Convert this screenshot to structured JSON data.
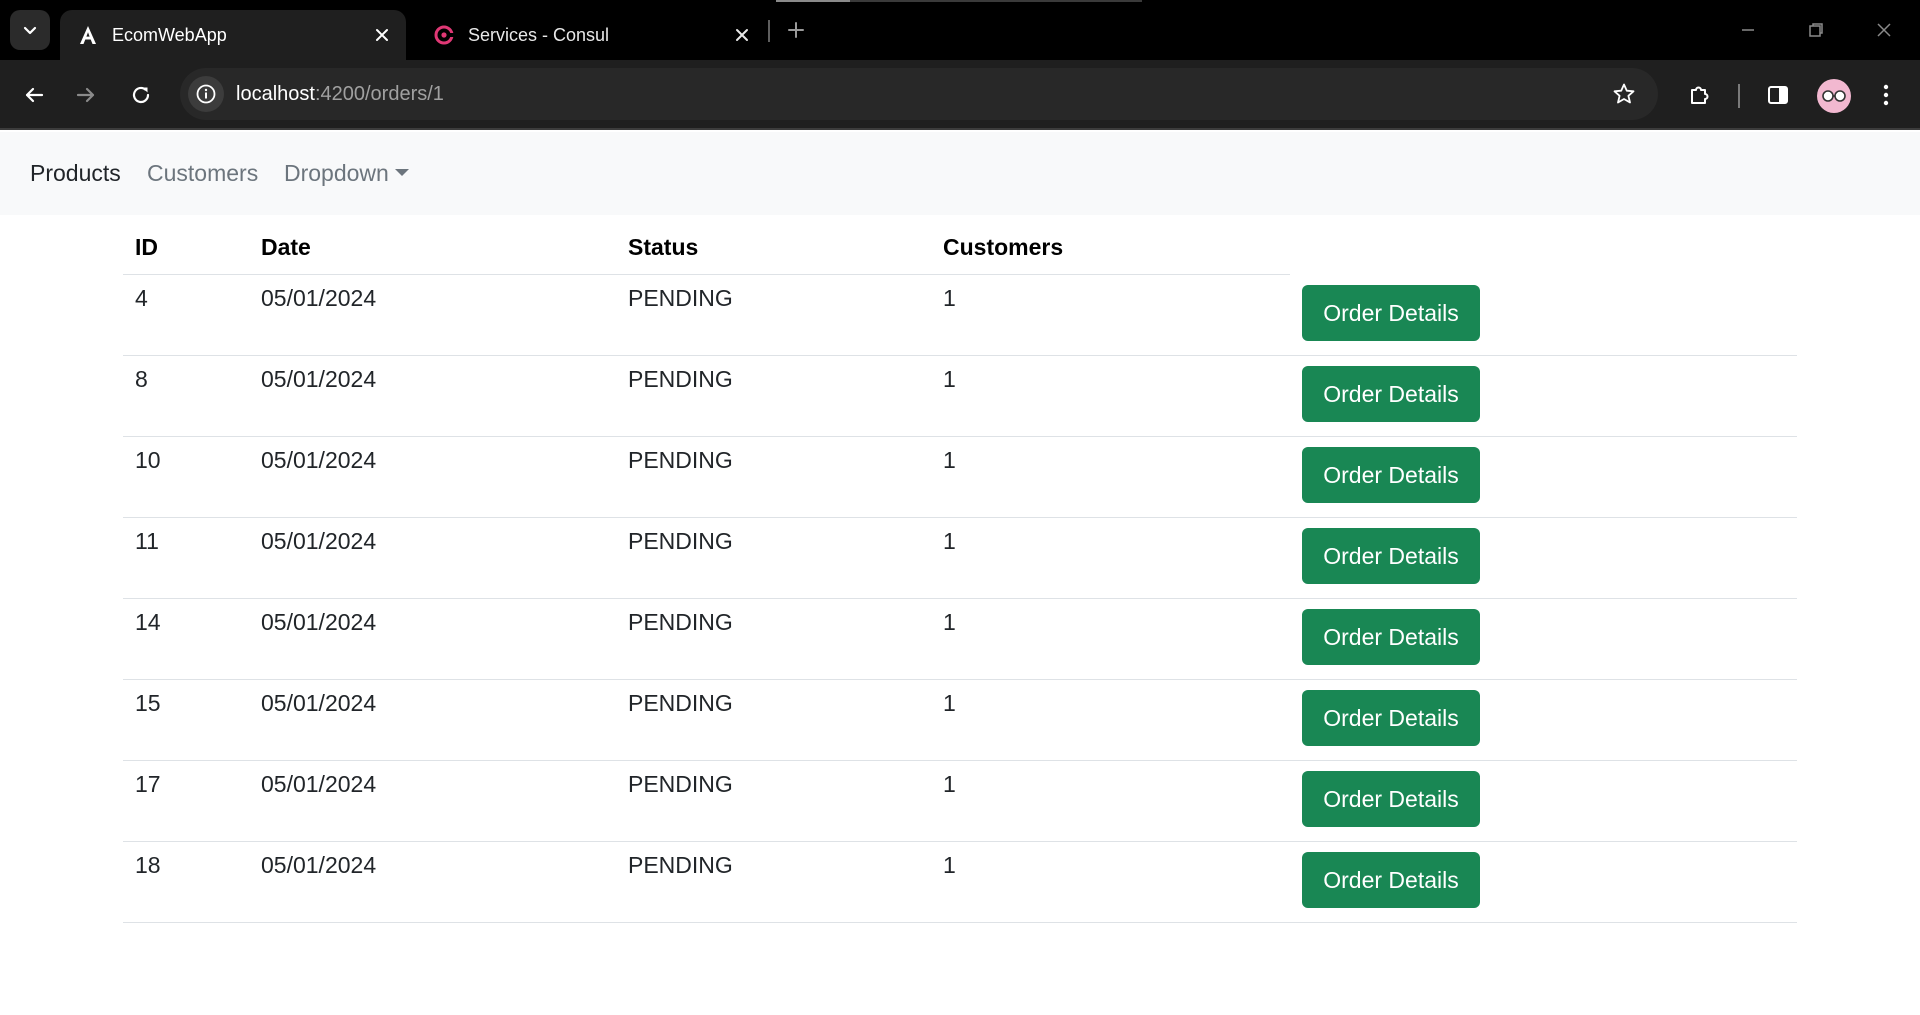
{
  "browser": {
    "tabs": [
      {
        "title": "EcomWebApp",
        "icon": "angular-icon",
        "active": true
      },
      {
        "title": "Services - Consul",
        "icon": "consul-icon",
        "active": false
      }
    ],
    "url": {
      "host": "localhost",
      "rest": ":4200/orders/1"
    }
  },
  "navbar": {
    "links": [
      {
        "label": "Products",
        "active": true
      },
      {
        "label": "Customers",
        "active": false
      }
    ],
    "dropdown_label": "Dropdown"
  },
  "table": {
    "headers": [
      "ID",
      "Date",
      "Status",
      "Customers"
    ],
    "button_label": "Order Details",
    "rows": [
      {
        "id": "4",
        "date": "05/01/2024",
        "status": "PENDING",
        "customers": "1"
      },
      {
        "id": "8",
        "date": "05/01/2024",
        "status": "PENDING",
        "customers": "1"
      },
      {
        "id": "10",
        "date": "05/01/2024",
        "status": "PENDING",
        "customers": "1"
      },
      {
        "id": "11",
        "date": "05/01/2024",
        "status": "PENDING",
        "customers": "1"
      },
      {
        "id": "14",
        "date": "05/01/2024",
        "status": "PENDING",
        "customers": "1"
      },
      {
        "id": "15",
        "date": "05/01/2024",
        "status": "PENDING",
        "customers": "1"
      },
      {
        "id": "17",
        "date": "05/01/2024",
        "status": "PENDING",
        "customers": "1"
      },
      {
        "id": "18",
        "date": "05/01/2024",
        "status": "PENDING",
        "customers": "1"
      }
    ]
  },
  "colors": {
    "button": "#198754",
    "navbar_bg": "#f8f9fa",
    "chrome_bg": "#000000",
    "toolbar_bg": "#1f1f1f"
  }
}
